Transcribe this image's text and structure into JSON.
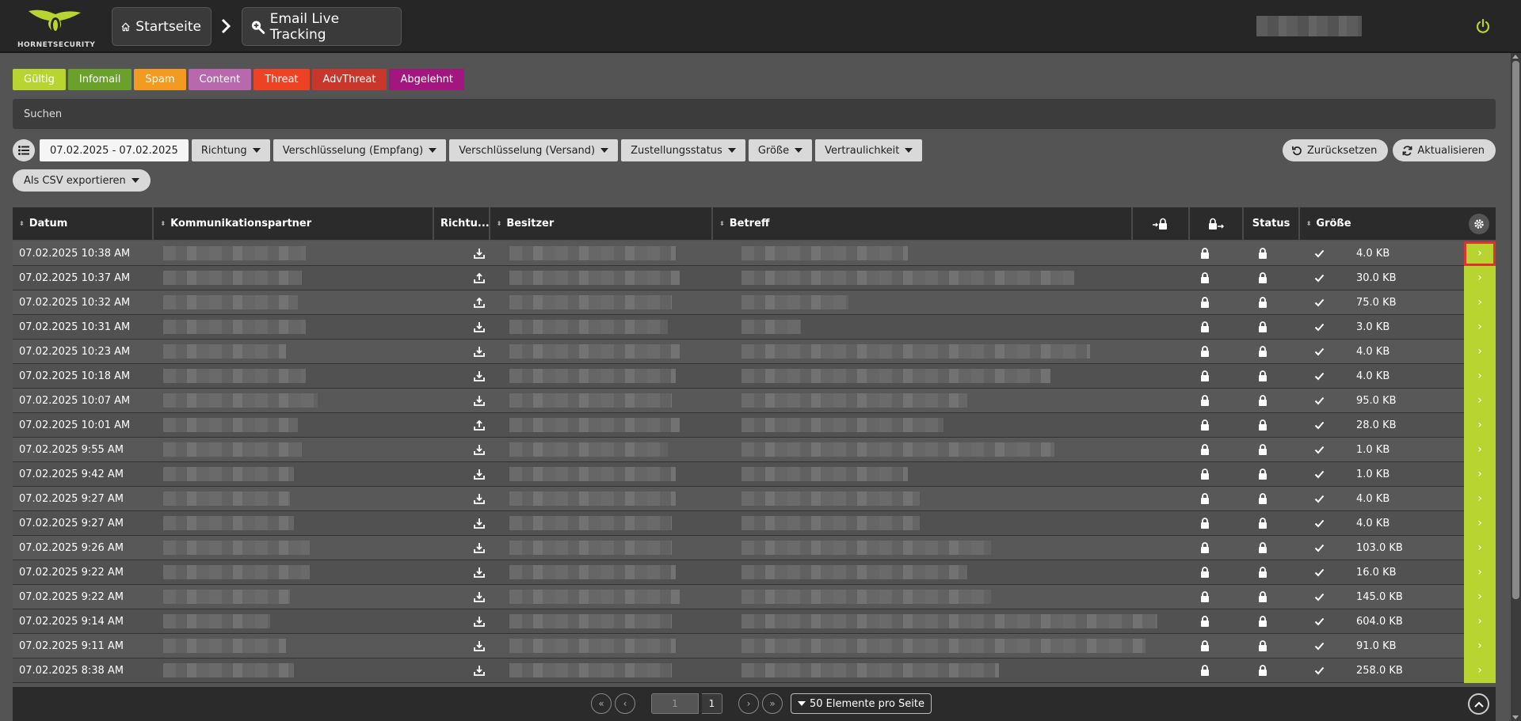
{
  "header": {
    "logo_text": "HORNETSECURITY",
    "breadcrumb": [
      {
        "label": "Startseite",
        "icon": "home-icon"
      },
      {
        "label": "Email Live Tracking",
        "icon": "search-plus-icon"
      }
    ],
    "accent": "#b8d430"
  },
  "categories": [
    {
      "label": "Gültig",
      "color": "#b8d430"
    },
    {
      "label": "Infomail",
      "color": "#6aa02c"
    },
    {
      "label": "Spam",
      "color": "#f39a20"
    },
    {
      "label": "Content",
      "color": "#b869ad"
    },
    {
      "label": "Threat",
      "color": "#ee4224"
    },
    {
      "label": "AdvThreat",
      "color": "#c8362c"
    },
    {
      "label": "Abgelehnt",
      "color": "#a3167f"
    }
  ],
  "search": {
    "label": "Suchen"
  },
  "filters": {
    "date_range": "07.02.2025 - 07.02.2025",
    "richtung": "Richtung",
    "enc_in": "Verschlüsselung (Empfang)",
    "enc_out": "Verschlüsselung (Versand)",
    "delivery": "Zustellungsstatus",
    "size": "Größe",
    "confidentiality": "Vertraulichkeit",
    "reset": "Zurücksetzen",
    "refresh": "Aktualisieren",
    "export": "Als CSV exportieren"
  },
  "table": {
    "columns": {
      "date": "Datum",
      "partner": "Kommunikationspartner",
      "direction": "Richtu...",
      "owner": "Besitzer",
      "subject": "Betreff",
      "status": "Status",
      "size": "Größe"
    },
    "rows": [
      {
        "date": "07.02.2025 10:38 AM",
        "direction": "in",
        "size": "4.0 KB"
      },
      {
        "date": "07.02.2025 10:37 AM",
        "direction": "out",
        "size": "30.0 KB"
      },
      {
        "date": "07.02.2025 10:32 AM",
        "direction": "out",
        "size": "75.0 KB"
      },
      {
        "date": "07.02.2025 10:31 AM",
        "direction": "in",
        "size": "3.0 KB"
      },
      {
        "date": "07.02.2025 10:23 AM",
        "direction": "in",
        "size": "4.0 KB"
      },
      {
        "date": "07.02.2025 10:18 AM",
        "direction": "in",
        "size": "4.0 KB"
      },
      {
        "date": "07.02.2025 10:07 AM",
        "direction": "in",
        "size": "95.0 KB"
      },
      {
        "date": "07.02.2025 10:01 AM",
        "direction": "out",
        "size": "28.0 KB"
      },
      {
        "date": "07.02.2025 9:55 AM",
        "direction": "in",
        "size": "1.0 KB"
      },
      {
        "date": "07.02.2025 9:42 AM",
        "direction": "in",
        "size": "1.0 KB"
      },
      {
        "date": "07.02.2025 9:27 AM",
        "direction": "in",
        "size": "4.0 KB"
      },
      {
        "date": "07.02.2025 9:27 AM",
        "direction": "in",
        "size": "4.0 KB"
      },
      {
        "date": "07.02.2025 9:26 AM",
        "direction": "in",
        "size": "103.0 KB"
      },
      {
        "date": "07.02.2025 9:22 AM",
        "direction": "in",
        "size": "16.0 KB"
      },
      {
        "date": "07.02.2025 9:22 AM",
        "direction": "in",
        "size": "145.0 KB"
      },
      {
        "date": "07.02.2025 9:14 AM",
        "direction": "in",
        "size": "604.0 KB"
      },
      {
        "date": "07.02.2025 9:11 AM",
        "direction": "in",
        "size": "91.0 KB"
      },
      {
        "date": "07.02.2025 8:38 AM",
        "direction": "in",
        "size": "258.0 KB"
      }
    ]
  },
  "pagination": {
    "page_placeholder": "1",
    "total_pages": "1",
    "per_page": "50 Elemente pro Seite"
  }
}
